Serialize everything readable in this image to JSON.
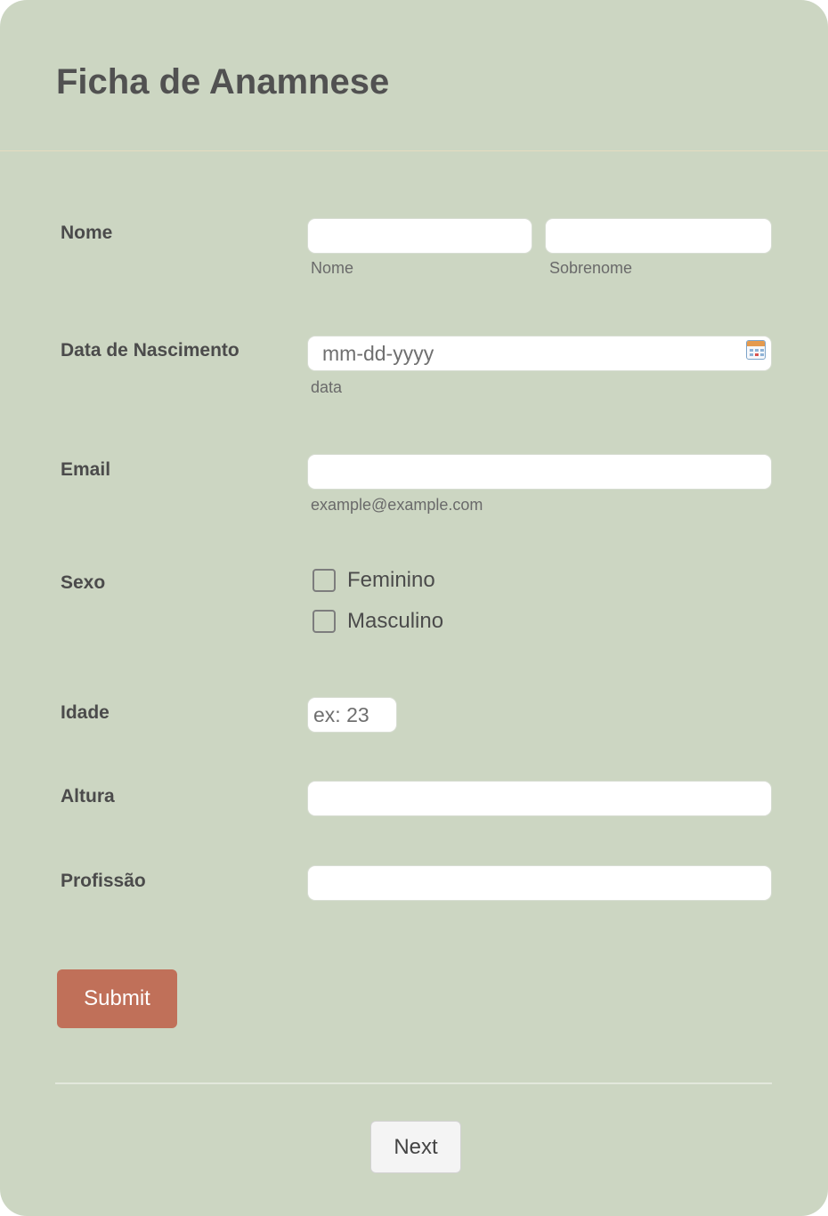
{
  "form": {
    "title": "Ficha de Anamnese"
  },
  "fields": {
    "name": {
      "label": "Nome",
      "first_value": "",
      "first_sublabel": "Nome",
      "last_value": "",
      "last_sublabel": "Sobrenome"
    },
    "birthdate": {
      "label": "Data de Nascimento",
      "placeholder": "mm-dd-yyyy",
      "value": "",
      "sublabel": "data",
      "icon": "calendar-icon"
    },
    "email": {
      "label": "Email",
      "value": "",
      "sublabel": "example@example.com"
    },
    "sex": {
      "label": "Sexo",
      "options": [
        {
          "label": "Feminino",
          "checked": false
        },
        {
          "label": "Masculino",
          "checked": false
        }
      ]
    },
    "age": {
      "label": "Idade",
      "placeholder": "ex: 23",
      "value": ""
    },
    "height": {
      "label": "Altura",
      "value": ""
    },
    "profession": {
      "label": "Profissão",
      "value": ""
    }
  },
  "actions": {
    "submit_label": "Submit",
    "next_label": "Next"
  },
  "colors": {
    "background": "#ccd6c2",
    "submit": "#c07059",
    "text": "#4b4b4b"
  }
}
